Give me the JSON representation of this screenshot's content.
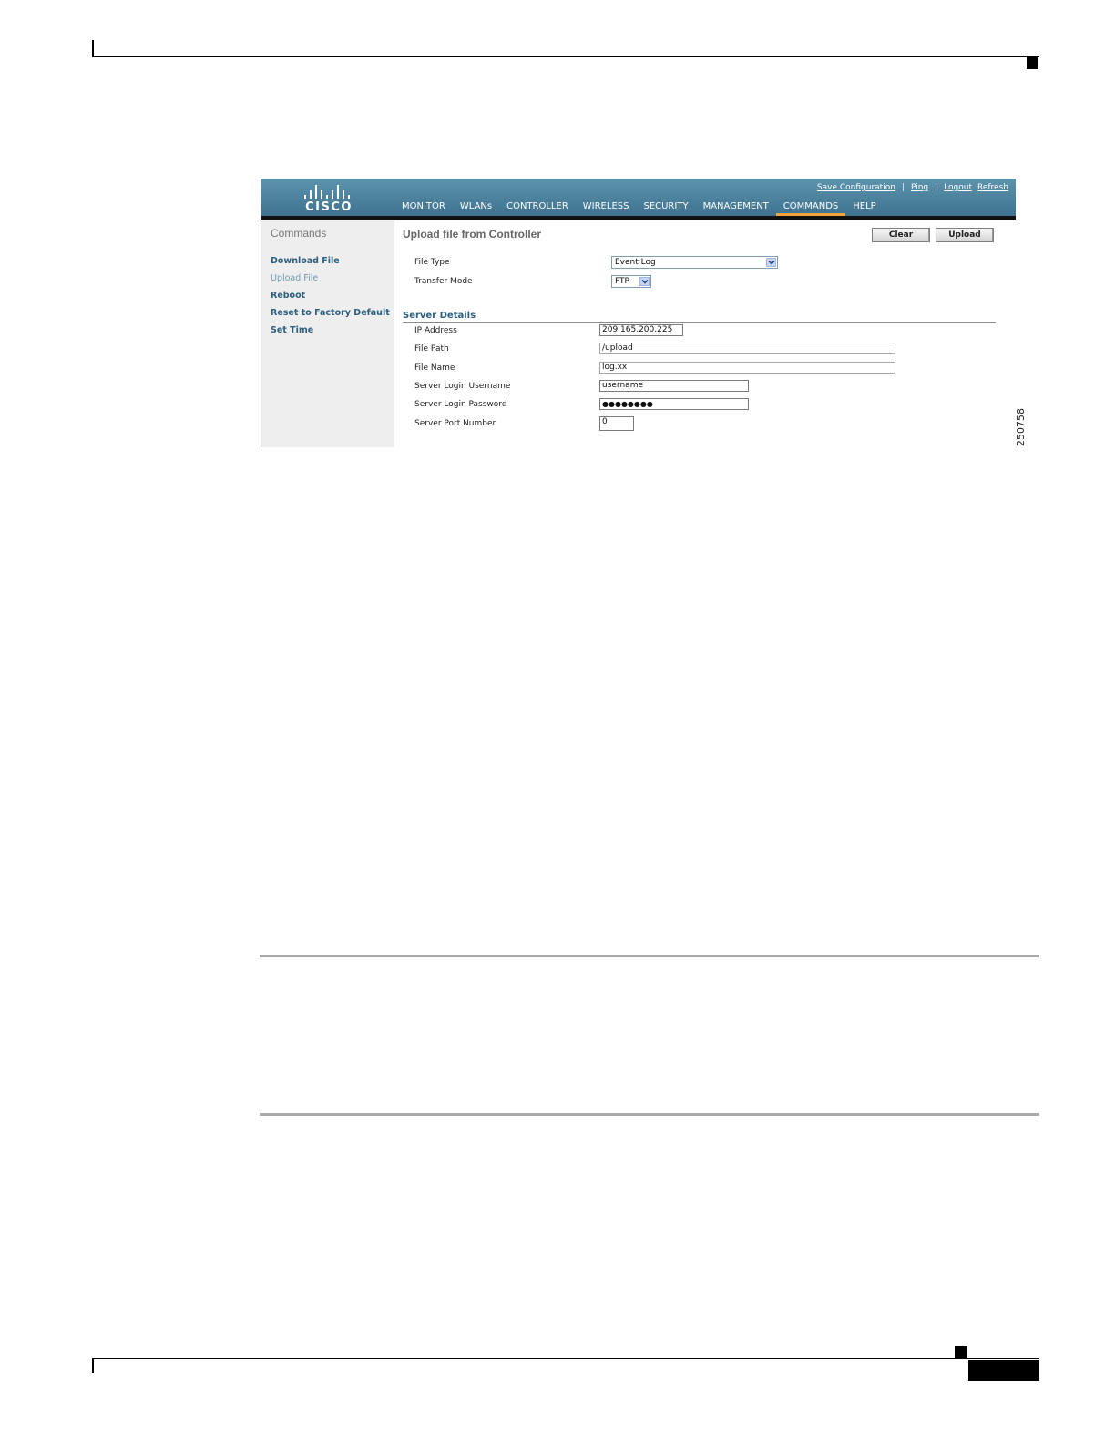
{
  "figure_id": "250758",
  "brand": {
    "logo_text": "CISCO"
  },
  "util_links": {
    "save": "Save Configuration",
    "ping": "Ping",
    "logout": "Logout",
    "refresh": "Refresh",
    "separator": "|"
  },
  "nav": {
    "items": [
      "MONITOR",
      "WLANs",
      "CONTROLLER",
      "WIRELESS",
      "SECURITY",
      "MANAGEMENT",
      "COMMANDS",
      "HELP"
    ],
    "active": "COMMANDS"
  },
  "sidebar": {
    "title": "Commands",
    "items": [
      "Download File",
      "Upload File",
      "Reboot",
      "Reset to Factory Default",
      "Set Time"
    ],
    "current": "Upload File"
  },
  "main": {
    "title": "Upload file from Controller",
    "buttons": {
      "clear": "Clear",
      "upload": "Upload"
    },
    "file_type": {
      "label": "File Type",
      "value": "Event Log"
    },
    "transfer_mode": {
      "label": "Transfer Mode",
      "value": "FTP"
    },
    "server_details": {
      "title": "Server Details",
      "ip_address": {
        "label": "IP Address",
        "value": "209.165.200.225"
      },
      "file_path": {
        "label": "File Path",
        "value": "/upload"
      },
      "file_name": {
        "label": "File Name",
        "value": "log.xx"
      },
      "username": {
        "label": "Server Login Username",
        "value": "username"
      },
      "password": {
        "label": "Server Login Password",
        "value": "●●●●●●●●"
      },
      "port": {
        "label": "Server Port Number",
        "value": "0"
      }
    }
  },
  "colors": {
    "header": "#4f86a2",
    "nav_active": "#f3a33a",
    "link": "#2c5f7d",
    "sidebar_bg": "#eeeeee"
  }
}
